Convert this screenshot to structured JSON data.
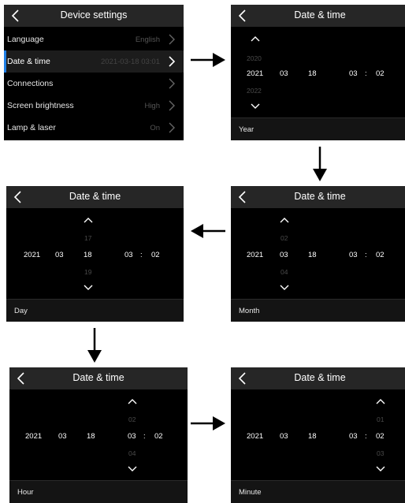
{
  "settings": {
    "title": "Device settings",
    "items": [
      {
        "label": "Language",
        "value": "English"
      },
      {
        "label": "Date & time",
        "value": "2021-03-18  03:01"
      },
      {
        "label": "Connections",
        "value": ""
      },
      {
        "label": "Screen brightness",
        "value": "High"
      },
      {
        "label": "Lamp & laser",
        "value": "On"
      }
    ]
  },
  "datetime": {
    "title": "Date & time",
    "year": "2021",
    "month": "03",
    "day": "18",
    "hour": "03",
    "separator": ":",
    "minute": "02"
  },
  "screens": {
    "year": {
      "prev": "2020",
      "next": "2022",
      "footer": "Year"
    },
    "month": {
      "prev": "02",
      "next": "04",
      "footer": "Month"
    },
    "day": {
      "prev": "17",
      "next": "19",
      "footer": "Day"
    },
    "hour": {
      "prev": "02",
      "next": "04",
      "footer": "Hour"
    },
    "minute": {
      "prev": "01",
      "next": "03",
      "footer": "Minute"
    }
  },
  "colors": {
    "accent": "#1f7fe5",
    "background": "#000000",
    "topbar": "#262626"
  }
}
